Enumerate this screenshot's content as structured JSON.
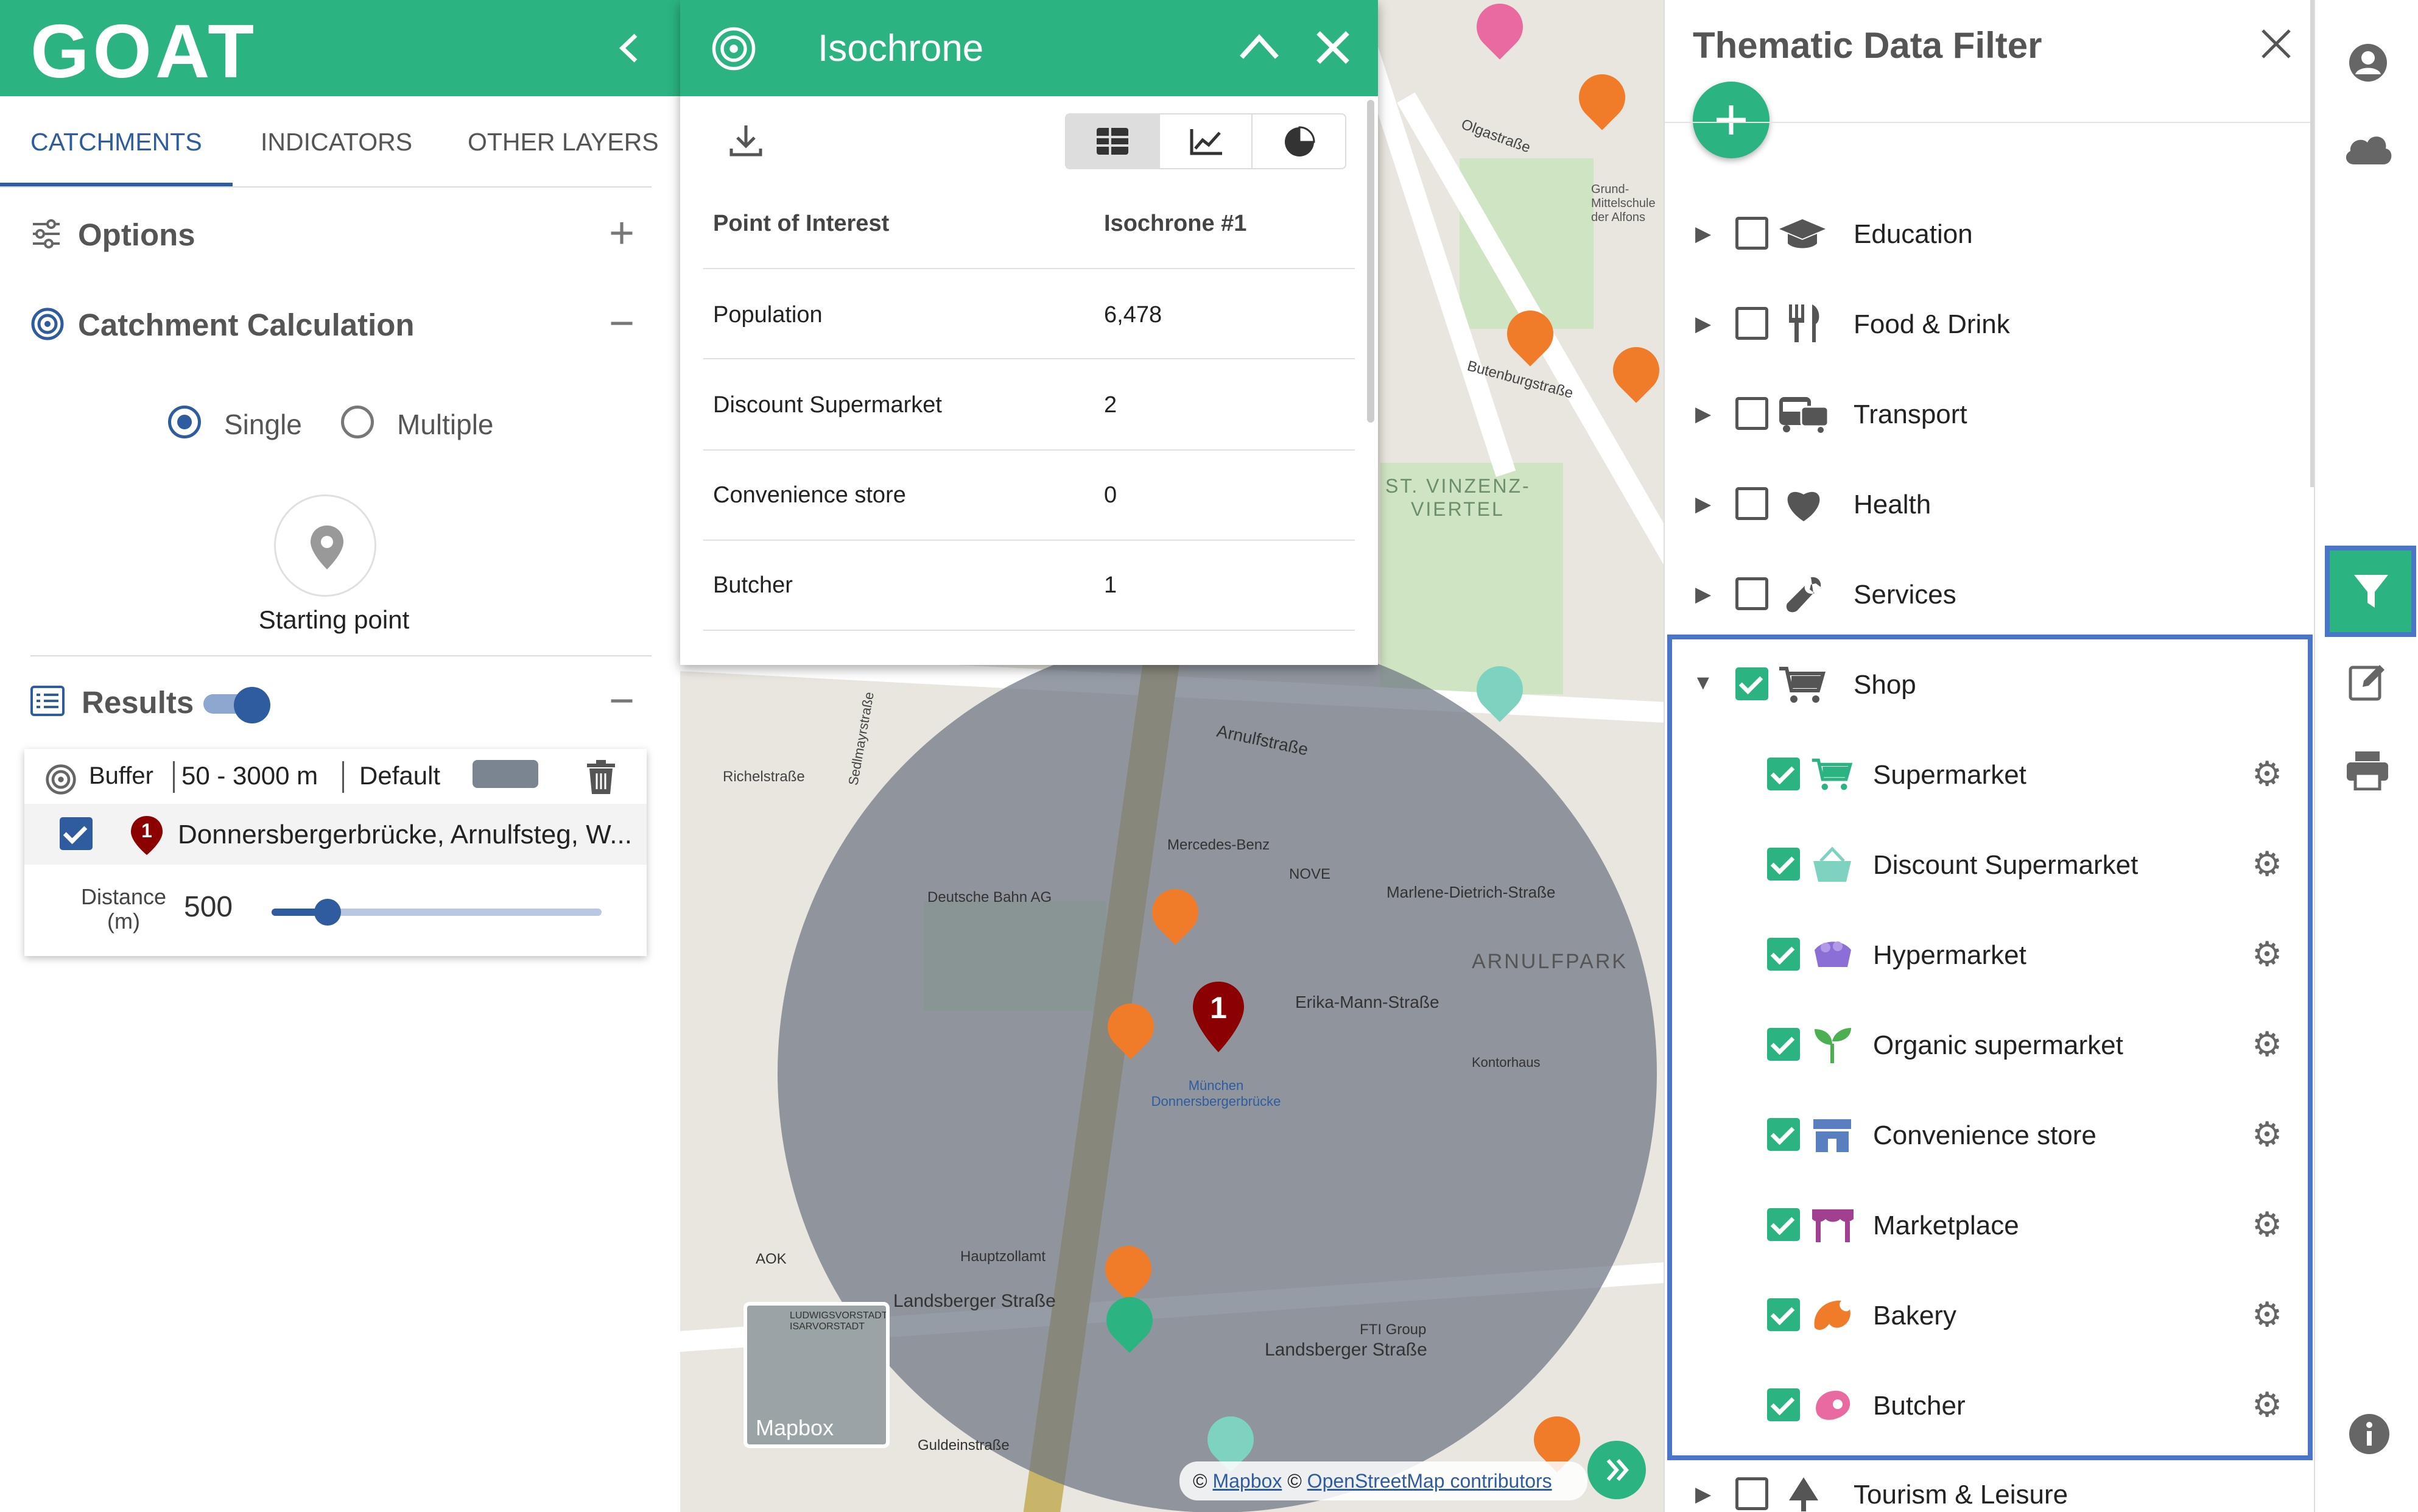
{
  "app": {
    "logo": "GOAT"
  },
  "left_panel": {
    "collapse_icon": "chevron-left-icon",
    "tabs": [
      "CATCHMENTS",
      "INDICATORS",
      "OTHER LAYERS"
    ],
    "options": {
      "label": "Options",
      "icon": "sliders-icon",
      "action": "+"
    },
    "catchment": {
      "label": "Catchment Calculation",
      "icon": "target-icon",
      "action": "−",
      "modes": [
        "Single",
        "Multiple"
      ],
      "selected_mode": "Single",
      "starting_point_label": "Starting point"
    },
    "results": {
      "label": "Results",
      "toggle_on": true,
      "action": "−",
      "item": {
        "type": "Buffer",
        "range": "50 - 3000 m",
        "style": "Default",
        "marker_number": "1",
        "location": "Donnersbergerbrücke, Arnulfsteg, W...",
        "distance_label": "Distance (m)",
        "distance_label_line1": "Distance",
        "distance_label_line2": "(m)",
        "distance_value": "500",
        "distance_fraction": 0.17
      }
    }
  },
  "isochrone_popup": {
    "title": "Isochrone",
    "view_icons": [
      "table-icon",
      "line-chart-icon",
      "pie-chart-icon"
    ],
    "header": [
      "Point of Interest",
      "Isochrone #1"
    ],
    "rows": [
      [
        "Population",
        "6,478"
      ],
      [
        "Discount Supermarket",
        "2"
      ],
      [
        "Convenience store",
        "0"
      ],
      [
        "Butcher",
        "1"
      ]
    ]
  },
  "map": {
    "labels": {
      "arnulfpark": "ARNULFPARK",
      "st_vinzenz": "ST. VINZENZ-",
      "viertel": "VIERTEL",
      "arnulfstrasse": "Arnulfstraße",
      "erika": "Erika-Mann-Straße",
      "marlene": "Marlene-Dietrich-Straße",
      "landsberger": "Landsberger Straße",
      "richelstrasse": "Richelstraße",
      "deutsche_bahn": "Deutsche Bahn AG",
      "mercedes": "Mercedes-Benz",
      "nove": "NOVE",
      "station": "München Donnersbergerbrücke",
      "hauptzollamt": "Hauptzollamt",
      "kontorhaus": "Kontorhaus",
      "fti": "FTI Group",
      "butenburg": "Butenburgstraße",
      "olgastrasse": "Olgastraße",
      "sedlmayr": "Sedlmayrstraße",
      "guldein": "Guldeinstraße",
      "aok": "AOK",
      "landsberger_str2": "Landsberger Straße",
      "marker": "1",
      "grund": "Grund-Mittelschule der Alfons"
    },
    "minimap_label": "Mapbox",
    "minimap_text": "LUDWIGSVORSTADT-ISARVORSTADT",
    "attribution": {
      "copyright": "©",
      "mapbox": "Mapbox",
      "osm": "OpenStreetMap contributors"
    },
    "expand_icon": "double-chevron-right-icon"
  },
  "filter_panel": {
    "title": "Thematic Data Filter",
    "add_icon": "plus-icon",
    "close_icon": "close-icon",
    "categories": [
      {
        "label": "Education",
        "icon": "graduation-cap-icon",
        "checked": false
      },
      {
        "label": "Food & Drink",
        "icon": "cutlery-icon",
        "checked": false
      },
      {
        "label": "Transport",
        "icon": "bus-icon",
        "checked": false
      },
      {
        "label": "Health",
        "icon": "heart-icon",
        "checked": false
      },
      {
        "label": "Services",
        "icon": "wrench-icon",
        "checked": false
      }
    ],
    "shop": {
      "label": "Shop",
      "icon": "cart-icon",
      "checked": true,
      "expanded": true,
      "items": [
        {
          "label": "Supermarket",
          "icon": "supermarket-cart-icon",
          "color": "#2bb381"
        },
        {
          "label": "Discount Supermarket",
          "icon": "basket-icon",
          "color": "#7dd3c0"
        },
        {
          "label": "Hypermarket",
          "icon": "hypermarket-icon",
          "color": "#8b6fd6"
        },
        {
          "label": "Organic supermarket",
          "icon": "sprout-icon",
          "color": "#4caf50"
        },
        {
          "label": "Convenience store",
          "icon": "store-icon",
          "color": "#5a7fc0"
        },
        {
          "label": "Marketplace",
          "icon": "market-stall-icon",
          "color": "#a0408f"
        },
        {
          "label": "Bakery",
          "icon": "croissant-icon",
          "color": "#f07c2a"
        },
        {
          "label": "Butcher",
          "icon": "meat-icon",
          "color": "#e86aa0"
        }
      ]
    },
    "more_category": {
      "label": "Tourism & Leisure",
      "icon": "tree-icon"
    }
  },
  "icon_bar": [
    "user-icon",
    "cloud-icon",
    "filter-icon",
    "edit-icon",
    "print-icon",
    "info-icon"
  ],
  "colors": {
    "brand_green": "#2bb381",
    "accent_blue": "#2e5c9e",
    "isochrone_fill": "#7b8592",
    "highlight_border": "#4a76c9"
  }
}
